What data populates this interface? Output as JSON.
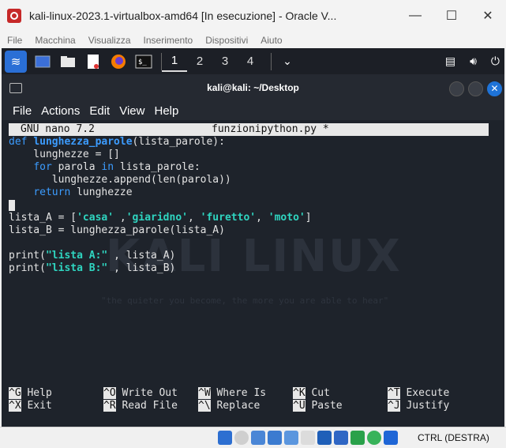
{
  "window": {
    "title": "kali-linux-2023.1-virtualbox-amd64 [In esecuzione] - Oracle V...",
    "minimize": "—",
    "maximize": "☐",
    "close": "✕"
  },
  "vbox_menu": [
    "File",
    "Macchina",
    "Visualizza",
    "Inserimento",
    "Dispositivi",
    "Aiuto"
  ],
  "kali_panel": {
    "workspaces": [
      "1",
      "2",
      "3",
      "4"
    ],
    "active_workspace": "1",
    "chevron": "⌄"
  },
  "terminal": {
    "title": "kali@kali: ~/Desktop",
    "menu": [
      "File",
      "Actions",
      "Edit",
      "View",
      "Help"
    ]
  },
  "nano": {
    "version": "GNU nano 7.2",
    "filename": "funzionipython.py *",
    "code": {
      "l1_kw": "def ",
      "l1_fn": "lunghezza_parole",
      "l1_rest": "(lista_parole):",
      "l2": "    lunghezze = []",
      "l3_indent": "    ",
      "l3_kw1": "for",
      "l3_mid": " parola ",
      "l3_kw2": "in",
      "l3_rest": " lista_parole:",
      "l4": "       lunghezze.append(len(parola))",
      "l5_indent": "    ",
      "l5_kw": "return",
      "l5_rest": " lunghezze",
      "l7_a": "lista_A = [",
      "l7_s1": "'casa'",
      "l7_b": " ,",
      "l7_s2": "'giaridno'",
      "l7_c": ", ",
      "l7_s3": "'furetto'",
      "l7_d": ", ",
      "l7_s4": "'moto'",
      "l7_e": "]",
      "l8": "lista_B = lunghezza_parole(lista_A)",
      "l10_a": "print(",
      "l10_s": "\"lista A:\"",
      "l10_b": " , lista_A)",
      "l11_a": "print(",
      "l11_s": "\"lista B:\"",
      "l11_b": " , lista_B)"
    },
    "shortcuts": [
      {
        "key": "^G",
        "label": " Help"
      },
      {
        "key": "^O",
        "label": " Write Out"
      },
      {
        "key": "^W",
        "label": " Where Is"
      },
      {
        "key": "^K",
        "label": " Cut"
      },
      {
        "key": "^T",
        "label": " Execute"
      },
      {
        "key": "^X",
        "label": " Exit"
      },
      {
        "key": "^R",
        "label": " Read File"
      },
      {
        "key": "^\\",
        "label": " Replace"
      },
      {
        "key": "^U",
        "label": " Paste"
      },
      {
        "key": "^J",
        "label": " Justify"
      }
    ]
  },
  "watermark": {
    "title": "KALI LINUX",
    "tagline": "\"the quieter you become, the more you are able to hear\""
  },
  "statusbar": {
    "host_key": "CTRL (DESTRA)"
  }
}
